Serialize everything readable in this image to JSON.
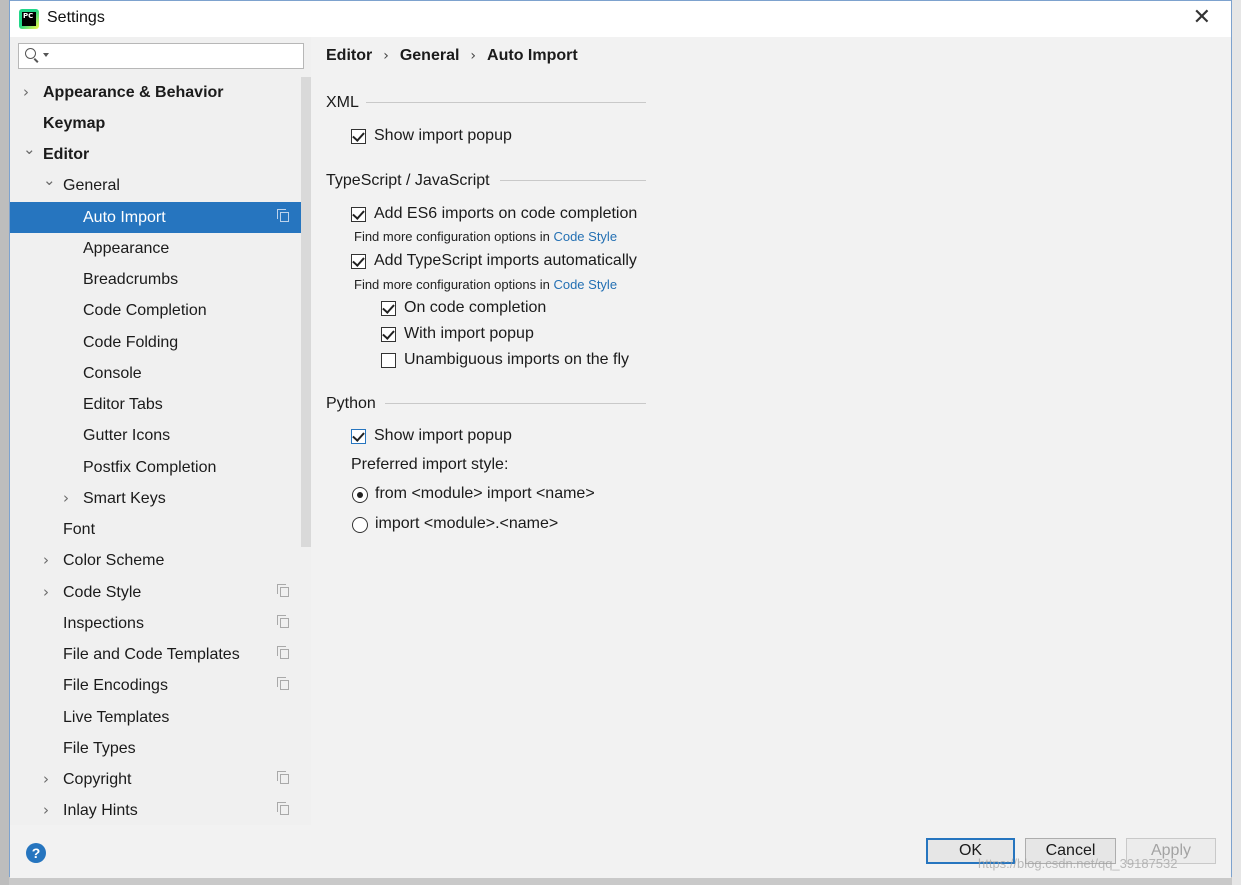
{
  "window": {
    "title": "Settings",
    "app_icon_text": "PC"
  },
  "search": {
    "placeholder": ""
  },
  "breadcrumb": [
    "Editor",
    "General",
    "Auto Import"
  ],
  "sidebar": {
    "items": [
      {
        "label": "Appearance & Behavior",
        "level": 0,
        "arrow": "right",
        "bold": true,
        "copy": false,
        "selected": false
      },
      {
        "label": "Keymap",
        "level": 0,
        "arrow": "none",
        "bold": true,
        "copy": false,
        "selected": false
      },
      {
        "label": "Editor",
        "level": 0,
        "arrow": "down",
        "bold": true,
        "copy": false,
        "selected": false
      },
      {
        "label": "General",
        "level": 1,
        "arrow": "down",
        "bold": false,
        "copy": false,
        "selected": false
      },
      {
        "label": "Auto Import",
        "level": 2,
        "arrow": "none",
        "bold": false,
        "copy": true,
        "selected": true
      },
      {
        "label": "Appearance",
        "level": 2,
        "arrow": "none",
        "bold": false,
        "copy": false,
        "selected": false
      },
      {
        "label": "Breadcrumbs",
        "level": 2,
        "arrow": "none",
        "bold": false,
        "copy": false,
        "selected": false
      },
      {
        "label": "Code Completion",
        "level": 2,
        "arrow": "none",
        "bold": false,
        "copy": false,
        "selected": false
      },
      {
        "label": "Code Folding",
        "level": 2,
        "arrow": "none",
        "bold": false,
        "copy": false,
        "selected": false
      },
      {
        "label": "Console",
        "level": 2,
        "arrow": "none",
        "bold": false,
        "copy": false,
        "selected": false
      },
      {
        "label": "Editor Tabs",
        "level": 2,
        "arrow": "none",
        "bold": false,
        "copy": false,
        "selected": false
      },
      {
        "label": "Gutter Icons",
        "level": 2,
        "arrow": "none",
        "bold": false,
        "copy": false,
        "selected": false
      },
      {
        "label": "Postfix Completion",
        "level": 2,
        "arrow": "none",
        "bold": false,
        "copy": false,
        "selected": false
      },
      {
        "label": "Smart Keys",
        "level": 2,
        "arrow": "right",
        "bold": false,
        "copy": false,
        "selected": false
      },
      {
        "label": "Font",
        "level": 1,
        "arrow": "none",
        "bold": false,
        "copy": false,
        "selected": false
      },
      {
        "label": "Color Scheme",
        "level": 1,
        "arrow": "right",
        "bold": false,
        "copy": false,
        "selected": false
      },
      {
        "label": "Code Style",
        "level": 1,
        "arrow": "right",
        "bold": false,
        "copy": true,
        "selected": false
      },
      {
        "label": "Inspections",
        "level": 1,
        "arrow": "none",
        "bold": false,
        "copy": true,
        "selected": false
      },
      {
        "label": "File and Code Templates",
        "level": 1,
        "arrow": "none",
        "bold": false,
        "copy": true,
        "selected": false
      },
      {
        "label": "File Encodings",
        "level": 1,
        "arrow": "none",
        "bold": false,
        "copy": true,
        "selected": false
      },
      {
        "label": "Live Templates",
        "level": 1,
        "arrow": "none",
        "bold": false,
        "copy": false,
        "selected": false
      },
      {
        "label": "File Types",
        "level": 1,
        "arrow": "none",
        "bold": false,
        "copy": false,
        "selected": false
      },
      {
        "label": "Copyright",
        "level": 1,
        "arrow": "right",
        "bold": false,
        "copy": true,
        "selected": false
      },
      {
        "label": "Inlay Hints",
        "level": 1,
        "arrow": "right",
        "bold": false,
        "copy": true,
        "selected": false
      }
    ]
  },
  "xml": {
    "section": "XML",
    "show_import_popup": {
      "label": "Show import popup",
      "checked": true
    }
  },
  "ts": {
    "section": "TypeScript / JavaScript",
    "es6": {
      "label": "Add ES6 imports on code completion",
      "checked": true
    },
    "hint1": {
      "prefix": "Find more configuration options in ",
      "link": "Code Style"
    },
    "ts_auto": {
      "label": "Add TypeScript imports automatically",
      "checked": true
    },
    "hint2": {
      "prefix": "Find more configuration options in ",
      "link": "Code Style"
    },
    "on_completion": {
      "label": "On code completion",
      "checked": true
    },
    "with_popup": {
      "label": "With import popup",
      "checked": true
    },
    "unambiguous": {
      "label": "Unambiguous imports on the fly",
      "checked": false
    }
  },
  "python": {
    "section": "Python",
    "show_import_popup": {
      "label": "Show import popup",
      "checked": true
    },
    "preferred_label": "Preferred import style:",
    "radio_from": {
      "label": "from <module> import <name>",
      "selected": true
    },
    "radio_import": {
      "label": "import <module>.<name>",
      "selected": false
    }
  },
  "footer": {
    "help": "?",
    "ok": "OK",
    "cancel": "Cancel",
    "apply": "Apply",
    "watermark": "https://blog.csdn.net/qq_39187532"
  },
  "colors": {
    "accent": "#2675bf",
    "link": "#2470b3",
    "selection": "#2675bf"
  }
}
